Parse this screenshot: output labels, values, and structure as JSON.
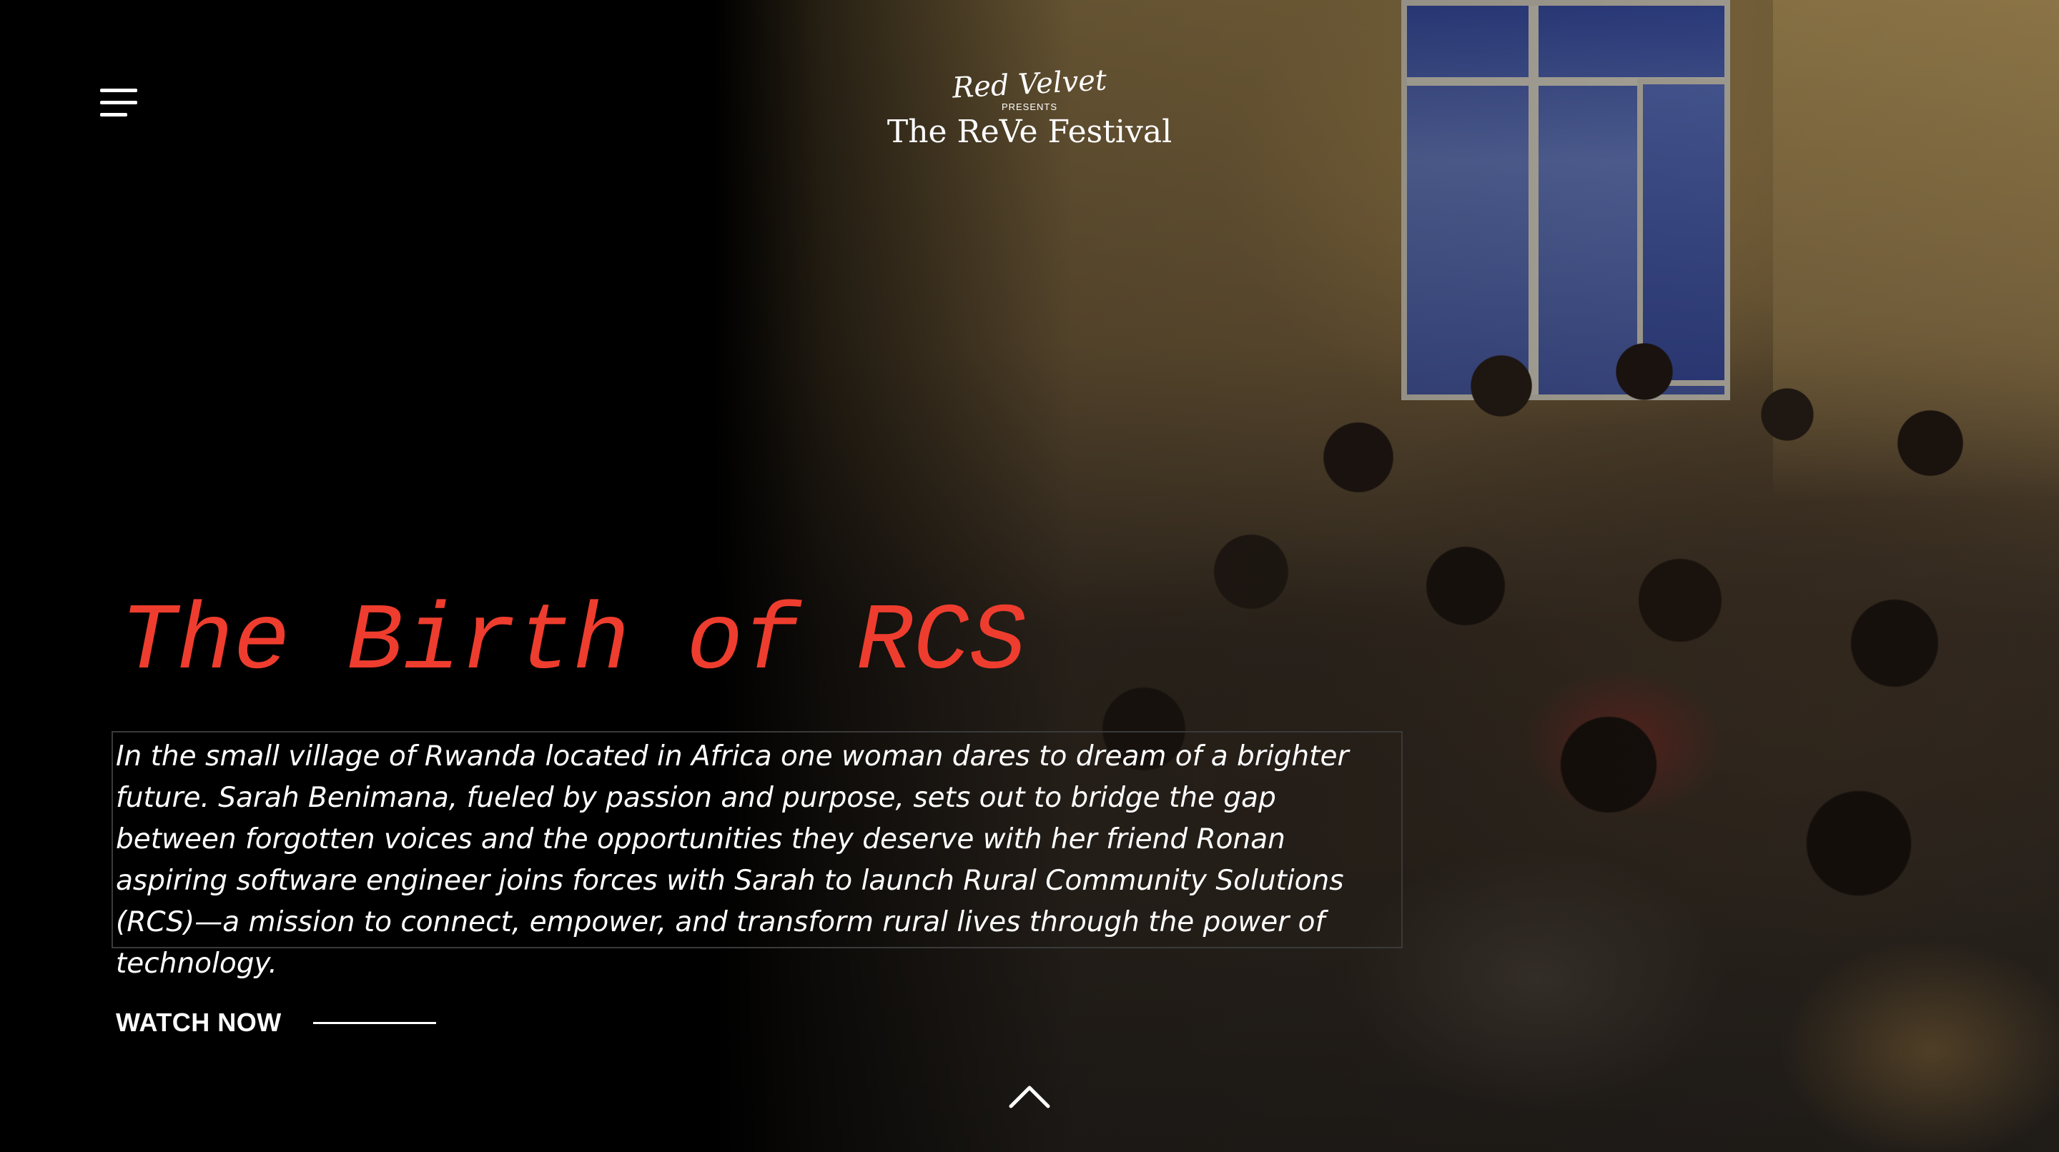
{
  "header": {
    "menu_icon": "hamburger-menu-icon",
    "logo": {
      "brand": "Red Velvet",
      "presents": "PRESENTS",
      "title": "The ReVe Festival"
    }
  },
  "hero": {
    "title": "The Birth of RCS",
    "description": "In the small village of Rwanda located in Africa one woman dares to dream of a brighter future. Sarah Benimana, fueled by passion and purpose, sets out to bridge the gap between forgotten voices and the opportunities they deserve with her friend Ronan aspiring software engineer  joins forces with Sarah to launch Rural Community Solutions (RCS)—a mission to connect, empower, and transform rural lives through the power of technology.",
    "cta_label": "WATCH NOW",
    "scroll_icon": "chevron-up-icon"
  },
  "colors": {
    "title_accent": "#ee3d2e",
    "text": "#ffffff",
    "background": "#000000"
  }
}
